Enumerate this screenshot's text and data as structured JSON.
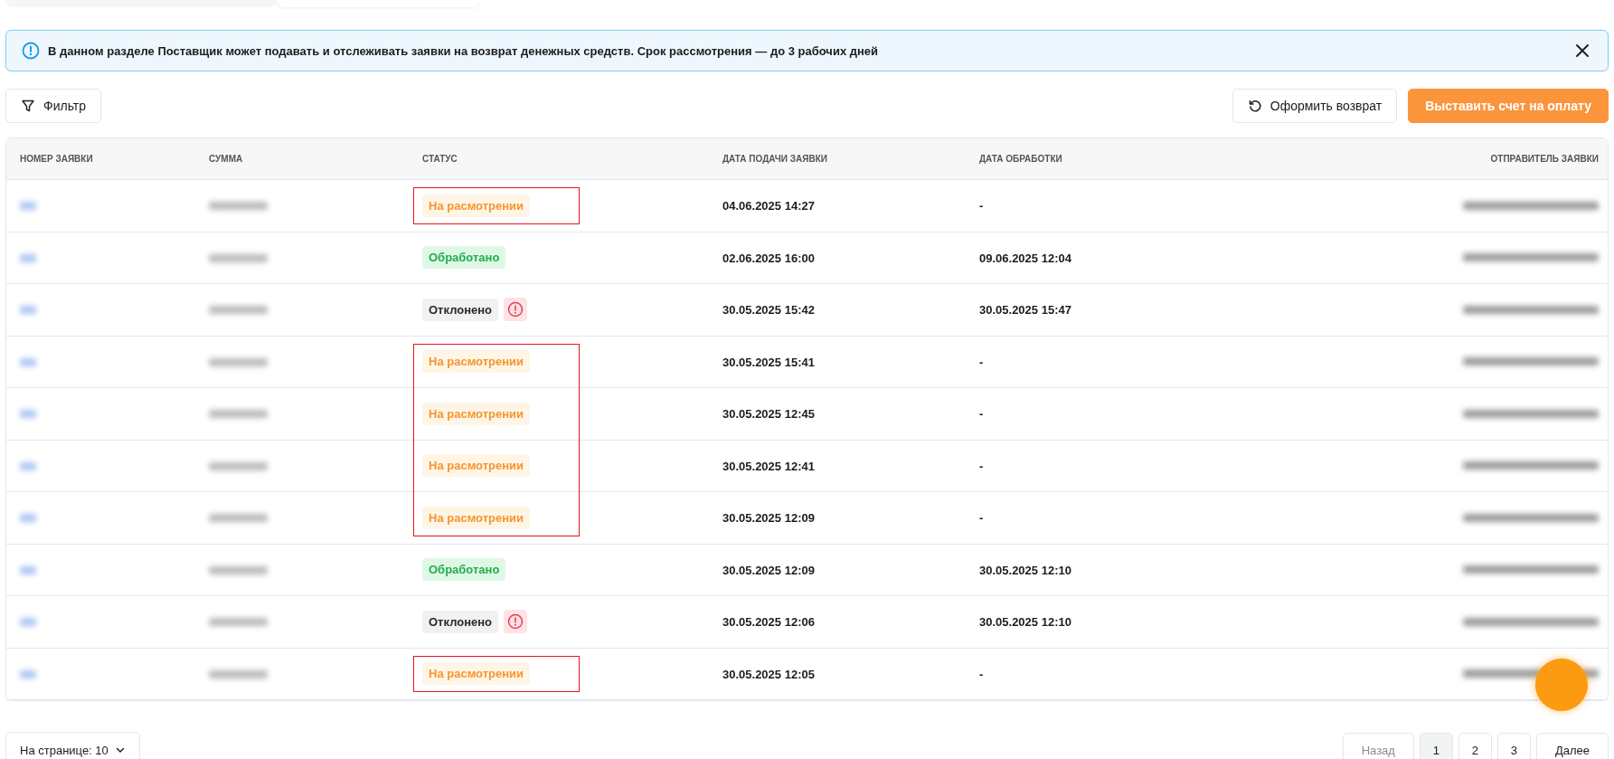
{
  "notice": {
    "text": "В данном разделе Поставщик может подавать и отслеживать заявки на возврат денежных средств. Срок рассмотрения — до 3 рабочих дней"
  },
  "toolbar": {
    "filter": "Фильтр",
    "refund": "Оформить возврат",
    "invoice": "Выставить счет на оплату"
  },
  "table": {
    "columns": [
      "НОМЕР ЗАЯВКИ",
      "СУММА",
      "СТАТУС",
      "ДАТА ПОДАЧИ ЗАЯВКИ",
      "ДАТА ОБРАБОТКИ",
      "ОТПРАВИТЕЛЬ ЗАЯВКИ"
    ],
    "rows": [
      {
        "status": "На расмотрении",
        "kind": "review",
        "submitted": "04.06.2025 14:27",
        "processed": "-",
        "marked": true
      },
      {
        "status": "Обработано",
        "kind": "done",
        "submitted": "02.06.2025 16:00",
        "processed": "09.06.2025 12:04",
        "marked": false
      },
      {
        "status": "Отклонено",
        "kind": "rejected",
        "submitted": "30.05.2025 15:42",
        "processed": "30.05.2025 15:47",
        "marked": false
      },
      {
        "status": "На расмотрении",
        "kind": "review",
        "submitted": "30.05.2025 15:41",
        "processed": "-",
        "marked": true
      },
      {
        "status": "На расмотрении",
        "kind": "review",
        "submitted": "30.05.2025 12:45",
        "processed": "-",
        "marked": true
      },
      {
        "status": "На расмотрении",
        "kind": "review",
        "submitted": "30.05.2025 12:41",
        "processed": "-",
        "marked": true
      },
      {
        "status": "На расмотрении",
        "kind": "review",
        "submitted": "30.05.2025 12:09",
        "processed": "-",
        "marked": true
      },
      {
        "status": "Обработано",
        "kind": "done",
        "submitted": "30.05.2025 12:09",
        "processed": "30.05.2025 12:10",
        "marked": false
      },
      {
        "status": "Отклонено",
        "kind": "rejected",
        "submitted": "30.05.2025 12:06",
        "processed": "30.05.2025 12:10",
        "marked": false
      },
      {
        "status": "На расмотрении",
        "kind": "review",
        "submitted": "30.05.2025 12:05",
        "processed": "-",
        "marked": true
      }
    ]
  },
  "page_size": "На странице: 10",
  "pagination": [
    {
      "label": "Назад",
      "kind": "prev",
      "selected": false,
      "disabled": true
    },
    {
      "label": "1",
      "kind": "page",
      "selected": true,
      "disabled": false
    },
    {
      "label": "2",
      "kind": "page",
      "selected": false,
      "disabled": false
    },
    {
      "label": "3",
      "kind": "page",
      "selected": false,
      "disabled": false
    },
    {
      "label": "Далее",
      "kind": "next",
      "selected": false,
      "disabled": false
    }
  ]
}
